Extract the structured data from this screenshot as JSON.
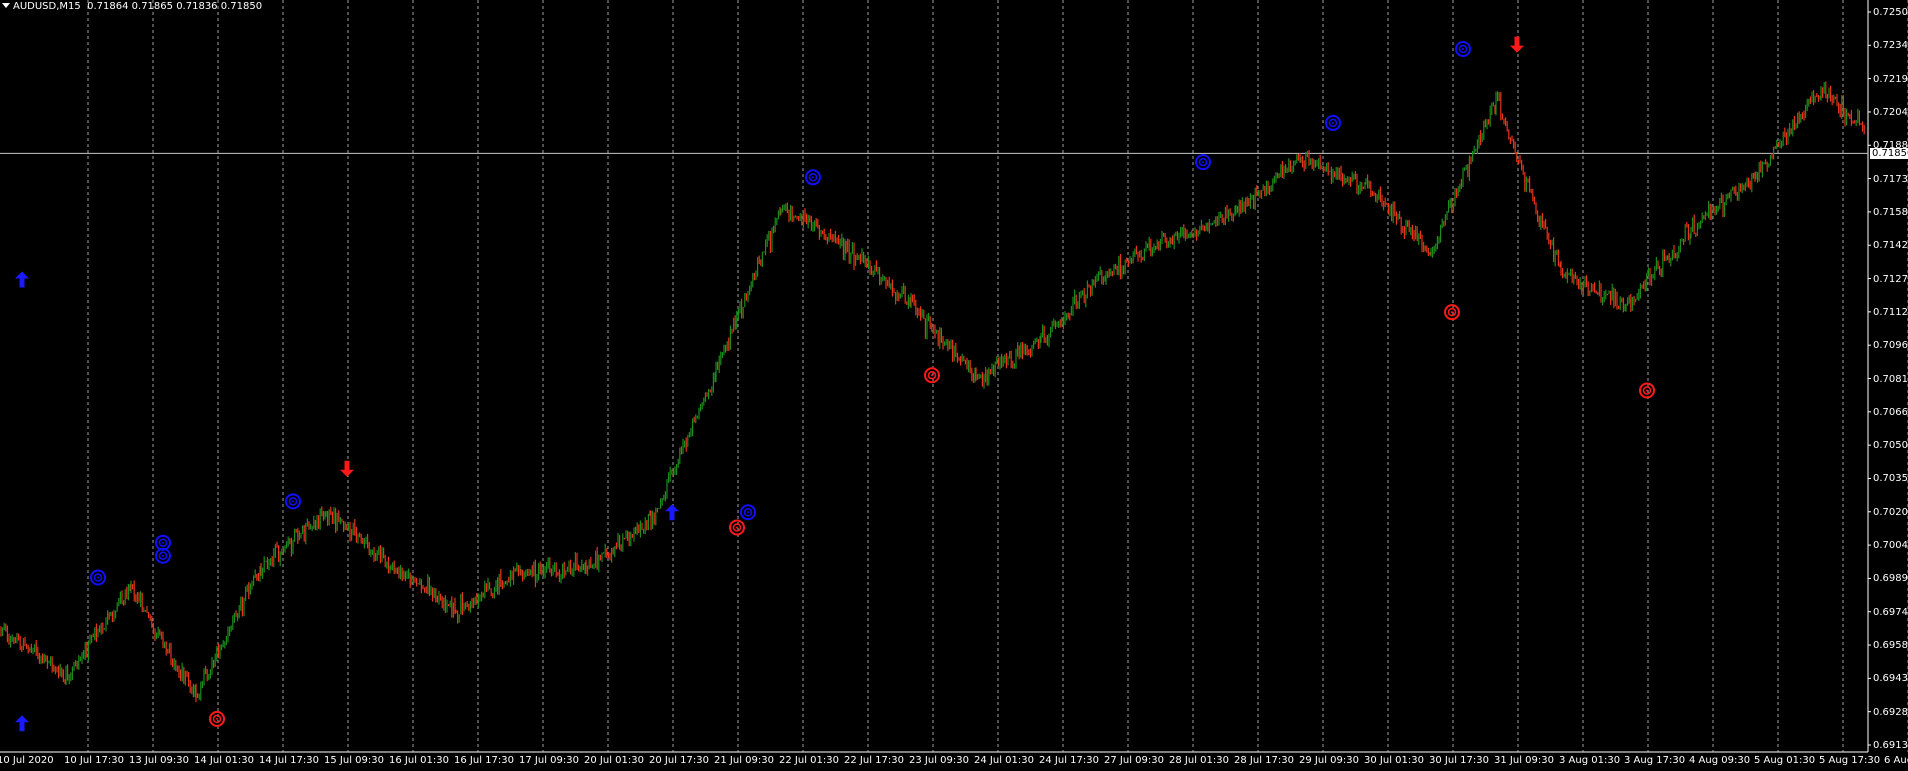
{
  "header": {
    "symbol": "AUDUSD,M15",
    "ohlc": "0.71864 0.71865 0.71836 0.71850"
  },
  "price_axis": {
    "labels": [
      "0.72500",
      "0.72345",
      "0.72190",
      "0.72040",
      "0.71885",
      "0.71730",
      "0.71580",
      "0.71425",
      "0.71270",
      "0.71120",
      "0.70965",
      "0.70810",
      "0.70660",
      "0.70505",
      "0.70350",
      "0.70200",
      "0.70045",
      "0.69890",
      "0.69740",
      "0.69585",
      "0.69435",
      "0.69280",
      "0.69130"
    ],
    "current_price": "0.71850"
  },
  "time_axis": {
    "labels": [
      "10 Jul 2020",
      "10 Jul 17:30",
      "13 Jul 09:30",
      "14 Jul 01:30",
      "14 Jul 17:30",
      "15 Jul 09:30",
      "16 Jul 01:30",
      "16 Jul 17:30",
      "17 Jul 09:30",
      "20 Jul 01:30",
      "20 Jul 17:30",
      "21 Jul 09:30",
      "22 Jul 01:30",
      "22 Jul 17:30",
      "23 Jul 09:30",
      "24 Jul 01:30",
      "24 Jul 17:30",
      "27 Jul 09:30",
      "28 Jul 01:30",
      "28 Jul 17:30",
      "29 Jul 09:30",
      "30 Jul 01:30",
      "30 Jul 17:30",
      "31 Jul 09:30",
      "3 Aug 01:30",
      "3 Aug 17:30",
      "4 Aug 09:30",
      "5 Aug 01:30",
      "5 Aug 17:30",
      "6 Aug 09:30"
    ]
  },
  "colors": {
    "background": "#000000",
    "bull": "#1c8c1c",
    "bear": "#e8341c",
    "grid": "#c8c8c8",
    "axis_text": "#ffffff",
    "target_blue": "#1010ff",
    "target_red": "#ff1a1a",
    "arrow_up": "#1a1aff",
    "arrow_down": "#ff1a1a"
  },
  "chart_data": {
    "type": "candlestick",
    "symbol": "AUDUSD",
    "timeframe": "M15",
    "ylim": [
      0.6913,
      0.725
    ],
    "path": [
      [
        "10 Jul 2020",
        0.6966
      ],
      [
        "10 Jul 17:30",
        0.6945
      ],
      [
        "13 Jul 09:30",
        0.6985
      ],
      [
        "14 Jul 01:30",
        0.6935
      ],
      [
        "14 Jul 17:30",
        0.6995
      ],
      [
        "15 Jul 09:30",
        0.702
      ],
      [
        "16 Jul 01:30",
        0.6995
      ],
      [
        "16 Jul 17:30",
        0.6975
      ],
      [
        "17 Jul 09:30",
        0.6992
      ],
      [
        "20 Jul 01:30",
        0.6995
      ],
      [
        "20 Jul 17:30",
        0.7015
      ],
      [
        "21 Jul 09:30",
        0.7085
      ],
      [
        "22 Jul 01:30",
        0.716
      ],
      [
        "22 Jul 17:30",
        0.7142
      ],
      [
        "23 Jul 09:30",
        0.7115
      ],
      [
        "24 Jul 01:30",
        0.708
      ],
      [
        "24 Jul 17:30",
        0.71
      ],
      [
        "27 Jul 09:30",
        0.713
      ],
      [
        "28 Jul 01:30",
        0.7145
      ],
      [
        "28 Jul 17:30",
        0.7158
      ],
      [
        "29 Jul 09:30",
        0.7183
      ],
      [
        "30 Jul 01:30",
        0.717
      ],
      [
        "30 Jul 17:30",
        0.714
      ],
      [
        "31 Jul 09:30",
        0.721
      ],
      [
        "3 Aug 01:30",
        0.713
      ],
      [
        "3 Aug 17:30",
        0.7115
      ],
      [
        "4 Aug 09:30",
        0.715
      ],
      [
        "5 Aug 01:30",
        0.7175
      ],
      [
        "5 Aug 17:30",
        0.7215
      ],
      [
        "6 Aug 09:30",
        0.7185
      ]
    ],
    "signals": [
      {
        "kind": "target",
        "color": "blue",
        "time": "10 Jul 17:30",
        "price": 0.699
      },
      {
        "kind": "target",
        "color": "blue",
        "time": "13 Jul 09:30",
        "price": 0.7
      },
      {
        "kind": "target",
        "color": "blue",
        "time": "13 Jul 09:30",
        "price": 0.7006
      },
      {
        "kind": "target",
        "color": "blue",
        "time": "14 Jul 17:30",
        "price": 0.7025
      },
      {
        "kind": "target",
        "color": "blue",
        "time": "21 Jul 09:30",
        "price": 0.702
      },
      {
        "kind": "target",
        "color": "blue",
        "time": "22 Jul 01:30",
        "price": 0.7174
      },
      {
        "kind": "target",
        "color": "blue",
        "time": "28 Jul 01:30",
        "price": 0.7181
      },
      {
        "kind": "target",
        "color": "blue",
        "time": "29 Jul 09:30",
        "price": 0.7199
      },
      {
        "kind": "target",
        "color": "blue",
        "time": "30 Jul 17:30",
        "price": 0.7233
      },
      {
        "kind": "target",
        "color": "red",
        "time": "14 Jul 01:30",
        "price": 0.6925
      },
      {
        "kind": "target",
        "color": "red",
        "time": "21 Jul 09:30",
        "price": 0.7013
      },
      {
        "kind": "target",
        "color": "red",
        "time": "23 Jul 09:30",
        "price": 0.7083
      },
      {
        "kind": "target",
        "color": "red",
        "time": "30 Jul 17:30",
        "price": 0.7112
      },
      {
        "kind": "target",
        "color": "red",
        "time": "3 Aug 17:30",
        "price": 0.7076
      },
      {
        "kind": "arrow",
        "dir": "up",
        "time": "10 Jul 2020",
        "price": 0.6923
      },
      {
        "kind": "arrow",
        "dir": "up",
        "time": "20 Jul 17:30",
        "price": 0.702
      },
      {
        "kind": "arrow",
        "dir": "up",
        "time": "30 Jul 09:30",
        "price": 0.7127
      },
      {
        "kind": "arrow",
        "dir": "down",
        "time": "15 Jul 09:30",
        "price": 0.704
      },
      {
        "kind": "arrow",
        "dir": "down",
        "time": "31 Jul 09:30",
        "price": 0.7235
      }
    ]
  }
}
